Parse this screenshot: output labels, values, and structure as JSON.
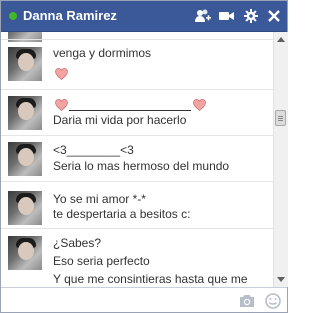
{
  "chat": {
    "contact_name": "Danna Ramirez",
    "status": "online",
    "colors": {
      "header": "#3b5998",
      "online": "#42b72a",
      "heart": "#f08a8a"
    },
    "header_icons": [
      "add-friend-icon",
      "video-call-icon",
      "gear-icon",
      "close-icon"
    ]
  },
  "messages": [
    {
      "lines": [
        "venga y dormimos"
      ],
      "has_heart": true
    },
    {
      "lines": [
        "Daria mi vida por hacerlo"
      ],
      "has_heart_line": true
    },
    {
      "lines": [
        "<3________<3",
        "Seria lo mas hermoso del mundo"
      ]
    },
    {
      "lines": [
        "Yo se mi amor *-*",
        "te despertaria a besitos c:"
      ]
    },
    {
      "lines": [
        "¿Sabes?",
        "Eso seria perfecto",
        "Y que me consintieras hasta que me"
      ]
    }
  ],
  "composer": {
    "placeholder": "",
    "icons": [
      "camera-icon",
      "smiley-icon"
    ]
  }
}
